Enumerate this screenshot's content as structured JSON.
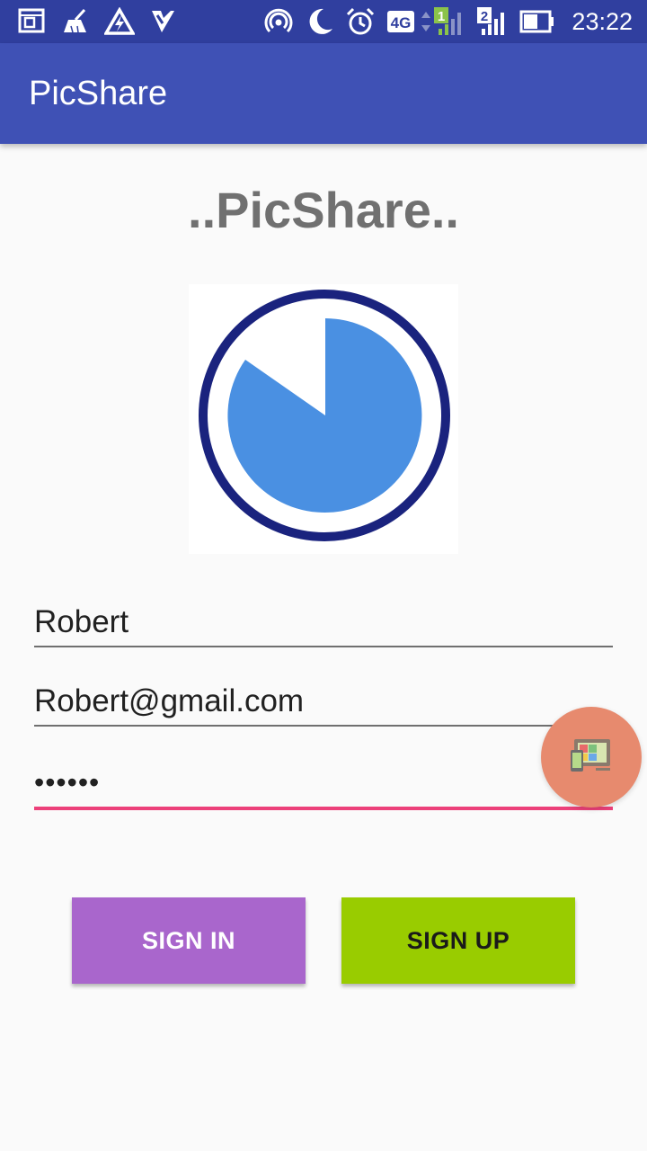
{
  "status_bar": {
    "time": "23:22",
    "network_type": "4G",
    "sim1_label": "1",
    "sim2_label": "2",
    "icons": [
      "screen-icon",
      "cleaner-icon",
      "alert-icon",
      "check-icon",
      "hotspot-icon",
      "moon-icon",
      "alarm-icon",
      "network-4g-icon",
      "signal-sim1-icon",
      "signal-sim2-icon",
      "battery-icon"
    ]
  },
  "app_bar": {
    "title": "PicShare"
  },
  "headline": "..PicShare..",
  "logo": {
    "icon": "picshare-logo-icon",
    "ring_color": "#1a237e",
    "fill_color": "#4a90e2"
  },
  "form": {
    "username_value": "Robert",
    "email_value": "Robert@gmail.com",
    "password_value": "••••••"
  },
  "buttons": {
    "sign_in_label": "SIGN IN",
    "sign_up_label": "SIGN UP"
  },
  "floating_button": {
    "icon": "screen-mirror-icon"
  },
  "colors": {
    "status_bar": "#303f9f",
    "app_bar": "#3f51b5",
    "focus_underline": "#ec407a",
    "sign_in": "#a966cc",
    "sign_up": "#99cc00",
    "fab": "#e78a6e"
  }
}
